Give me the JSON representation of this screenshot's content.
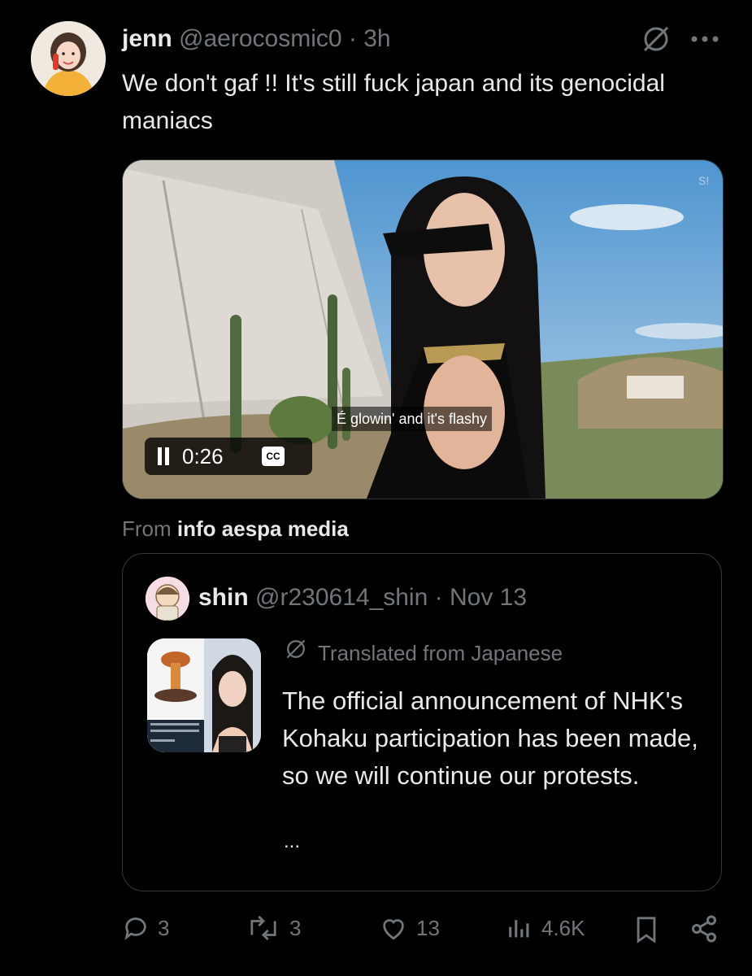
{
  "post": {
    "name": "jenn",
    "handle": "@aerocosmic0",
    "separator": "·",
    "time": "3h",
    "text": "We don't gaf !! It's still fuck japan and its genocidal maniacs"
  },
  "video": {
    "subtitle": "É glowin' and it's flashy",
    "time": "0:26",
    "cc_label": "CC",
    "watermark": "S!"
  },
  "source": {
    "prefix": "From",
    "name": "info aespa media"
  },
  "quote": {
    "name": "shin",
    "handle": "@r230614_shin",
    "separator": "·",
    "date": "Nov 13",
    "translated_label": "Translated from Japanese",
    "text": "The official announcement of NHK's Kohaku participation has been made, so we will continue our protests.",
    "ellipsis": "..."
  },
  "actions": {
    "replies": "3",
    "reposts": "3",
    "likes": "13",
    "views": "4.6K"
  },
  "icons": [
    "grok-icon",
    "more-icon",
    "pause-icon",
    "cc-icon",
    "reply-icon",
    "repost-icon",
    "like-icon",
    "views-icon",
    "bookmark-icon",
    "share-icon",
    "translate-icon"
  ]
}
